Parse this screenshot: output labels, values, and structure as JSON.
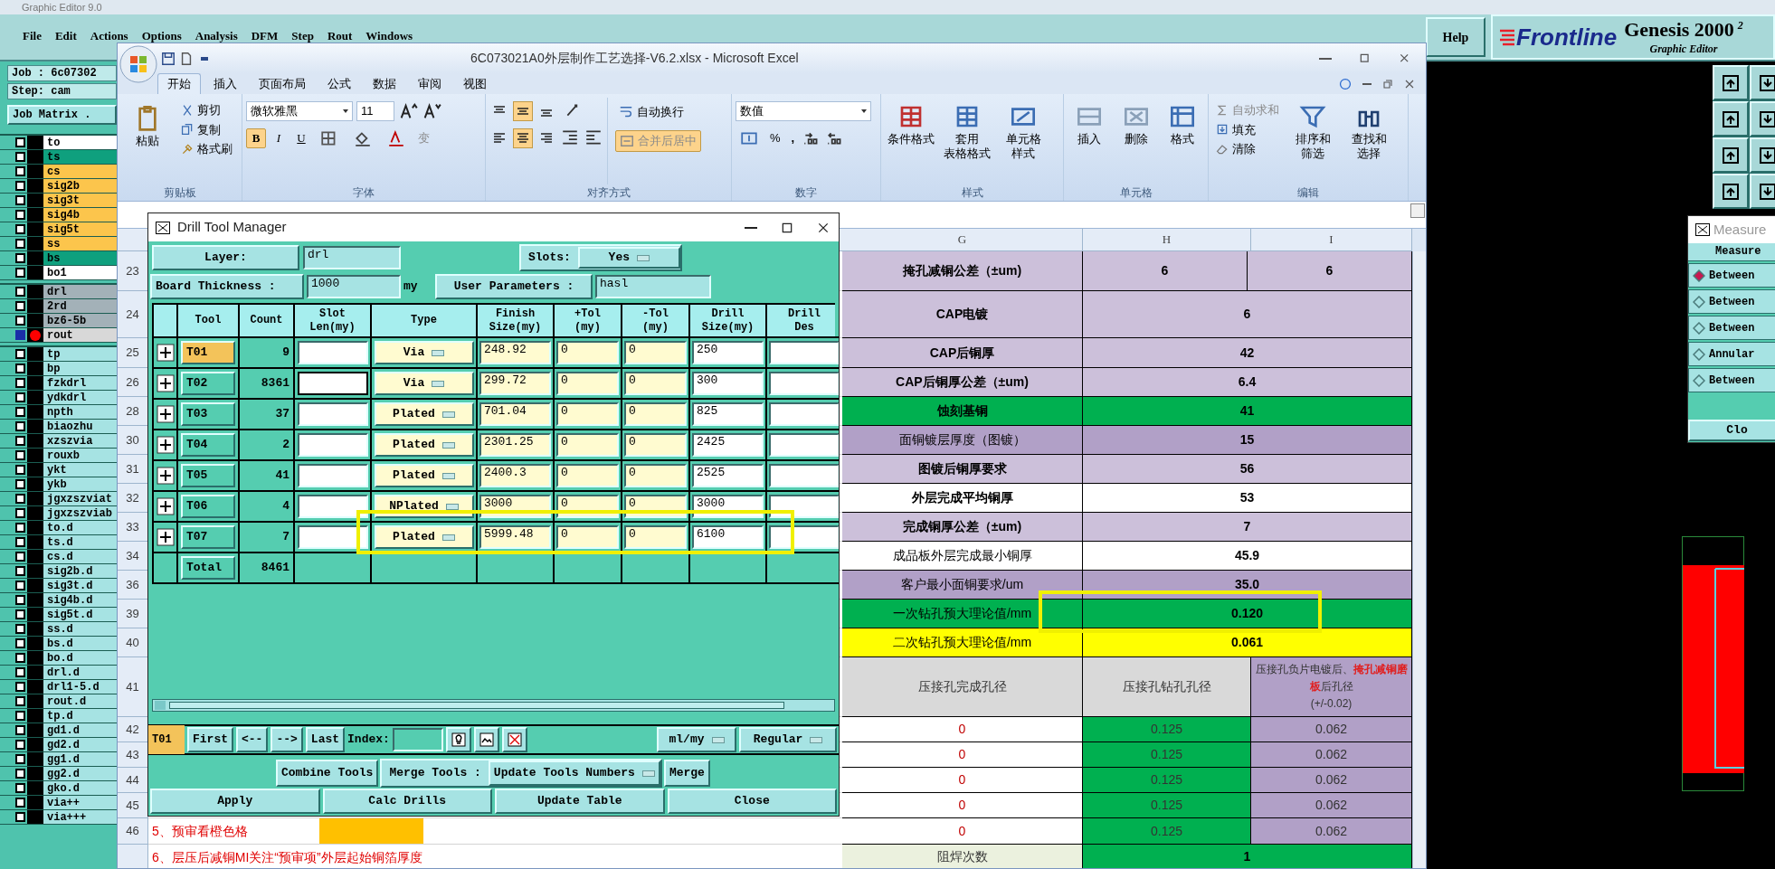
{
  "genesis": {
    "title": "Graphic Editor 9.0",
    "menu": [
      "File",
      "Edit",
      "Actions",
      "Options",
      "Analysis",
      "DFM",
      "Step",
      "Rout",
      "Windows"
    ],
    "help": "Help",
    "logo": {
      "brand": "Frontline",
      "product": "Genesis 2000",
      "superscript": "2",
      "subtitle": "Graphic Editor"
    },
    "job": "Job : 6c07302",
    "step": "Step: cam",
    "job_matrix": "Job Matrix .",
    "layer_groups": [
      {
        "layers": [
          {
            "name": "to",
            "color": "#ffffff",
            "selected": false
          },
          {
            "name": "ts",
            "color": "#0fa07e",
            "selected": false
          },
          {
            "name": "cs",
            "color": "#fcc54c",
            "selected": false
          },
          {
            "name": "sig2b",
            "color": "#fcc54c",
            "selected": false
          },
          {
            "name": "sig3t",
            "color": "#fcc54c",
            "selected": false
          },
          {
            "name": "sig4b",
            "color": "#fcc54c",
            "selected": false
          },
          {
            "name": "sig5t",
            "color": "#fcc54c",
            "selected": false
          },
          {
            "name": "ss",
            "color": "#fcc54c",
            "selected": false
          },
          {
            "name": "bs",
            "color": "#0fa07e",
            "selected": false
          },
          {
            "name": "bo1",
            "color": "#ffffff",
            "selected": false
          }
        ]
      },
      {
        "layers": [
          {
            "name": "drl",
            "color": "#a3b1b8",
            "selected": false
          },
          {
            "name": "2rd",
            "color": "#a3b1b8",
            "selected": false
          },
          {
            "name": "bz6-5b",
            "color": "#a3b1b8",
            "selected": false
          },
          {
            "name": "rout",
            "color": "#d8d8d8",
            "selected": true
          }
        ]
      },
      {
        "layers": [
          {
            "name": "tp",
            "color": "#a6e3e3",
            "selected": false
          },
          {
            "name": "bp",
            "color": "#a6e3e3",
            "selected": false
          },
          {
            "name": "fzkdrl",
            "color": "#a6e3e3",
            "selected": false
          },
          {
            "name": "ydkdrl",
            "color": "#a6e3e3",
            "selected": false
          },
          {
            "name": "npth",
            "color": "#a6e3e3",
            "selected": false
          },
          {
            "name": "biaozhu",
            "color": "#a6e3e3",
            "selected": false
          },
          {
            "name": "xzszvia",
            "color": "#a6e3e3",
            "selected": false
          },
          {
            "name": "rouxb",
            "color": "#a6e3e3",
            "selected": false
          },
          {
            "name": "ykt",
            "color": "#a6e3e3",
            "selected": false
          },
          {
            "name": "ykb",
            "color": "#a6e3e3",
            "selected": false
          },
          {
            "name": "jgxzszviat",
            "color": "#a6e3e3",
            "selected": false
          },
          {
            "name": "jgxzszviab",
            "color": "#a6e3e3",
            "selected": false
          },
          {
            "name": "to.d",
            "color": "#a6e3e3",
            "selected": false
          },
          {
            "name": "ts.d",
            "color": "#a6e3e3",
            "selected": false
          },
          {
            "name": "cs.d",
            "color": "#a6e3e3",
            "selected": false
          },
          {
            "name": "sig2b.d",
            "color": "#a6e3e3",
            "selected": false
          },
          {
            "name": "sig3t.d",
            "color": "#a6e3e3",
            "selected": false
          },
          {
            "name": "sig4b.d",
            "color": "#a6e3e3",
            "selected": false
          },
          {
            "name": "sig5t.d",
            "color": "#a6e3e3",
            "selected": false
          },
          {
            "name": "ss.d",
            "color": "#a6e3e3",
            "selected": false
          },
          {
            "name": "bs.d",
            "color": "#a6e3e3",
            "selected": false
          },
          {
            "name": "bo.d",
            "color": "#a6e3e3",
            "selected": false
          },
          {
            "name": "drl.d",
            "color": "#a6e3e3",
            "selected": false
          },
          {
            "name": "drl1-5.d",
            "color": "#a6e3e3",
            "selected": false
          },
          {
            "name": "rout.d",
            "color": "#a6e3e3",
            "selected": false
          },
          {
            "name": "tp.d",
            "color": "#a6e3e3",
            "selected": false
          },
          {
            "name": "gd1.d",
            "color": "#a6e3e3",
            "selected": false
          },
          {
            "name": "gd2.d",
            "color": "#a6e3e3",
            "selected": false
          },
          {
            "name": "gg1.d",
            "color": "#a6e3e3",
            "selected": false
          },
          {
            "name": "gg2.d",
            "color": "#a6e3e3",
            "selected": false
          },
          {
            "name": "gko.d",
            "color": "#a6e3e3",
            "selected": false
          },
          {
            "name": "via++",
            "color": "#a6e3e3",
            "selected": false
          },
          {
            "name": "via+++",
            "color": "#a6e3e3",
            "selected": false
          }
        ]
      }
    ]
  },
  "measure": {
    "title": "Measure",
    "header": "Measure",
    "options": [
      {
        "label": "Between",
        "selected": true
      },
      {
        "label": "Between",
        "selected": false
      },
      {
        "label": "Between",
        "selected": false
      },
      {
        "label": "Annular",
        "selected": false
      },
      {
        "label": "Between",
        "selected": false
      }
    ],
    "close": "Clo"
  },
  "excel": {
    "title": "6C073021A0外层制作工艺选择-V6.2.xlsx - Microsoft Excel",
    "tabs": [
      {
        "label": "开始",
        "selected": true
      },
      {
        "label": "插入",
        "selected": false
      },
      {
        "label": "页面布局",
        "selected": false
      },
      {
        "label": "公式",
        "selected": false
      },
      {
        "label": "数据",
        "selected": false
      },
      {
        "label": "审阅",
        "selected": false
      },
      {
        "label": "视图",
        "selected": false
      }
    ],
    "clipboard": {
      "label": "剪贴板",
      "paste": "粘贴",
      "cut": "剪切",
      "copy": "复制",
      "format_painter": "格式刷"
    },
    "font": {
      "label": "字体",
      "name": "微软雅黑",
      "size": "11",
      "bold": "B",
      "italic": "I",
      "underline": "U",
      "phonetic": "变"
    },
    "alignment": {
      "label": "对齐方式",
      "vertical": [
        {
          "selected": false
        },
        {
          "selected": true
        },
        {
          "selected": false
        }
      ],
      "horizontal": [
        {
          "selected": false
        },
        {
          "selected": true
        },
        {
          "selected": false
        }
      ],
      "wrap": "自动换行",
      "merge": {
        "label": "合并后居中",
        "disabled": true
      }
    },
    "number": {
      "label": "数字",
      "format": "数值",
      "percent": "%",
      "comma": ","
    },
    "styles": {
      "label": "样式",
      "conditional": "条件格式",
      "table": [
        "套用",
        "表格格式"
      ],
      "cell": [
        "单元格",
        "样式"
      ]
    },
    "cells": {
      "label": "单元格",
      "insert": "插入",
      "delete": "删除",
      "format": "格式"
    },
    "editing": {
      "label": "编辑",
      "autosum": {
        "label": "自动求和",
        "disabled": true
      },
      "fill": "填充",
      "clear": "清除",
      "sort": [
        "排序和",
        "筛选"
      ],
      "find": [
        "查找和",
        "选择"
      ]
    },
    "columns": [
      "G",
      "H",
      "I"
    ],
    "rows": [
      {
        "kind": "param",
        "number": "23",
        "label": "掩孔减铜公差（±um)",
        "values": [
          "6",
          "6"
        ],
        "color": "#ccc0da",
        "label_bold": true,
        "value_bold": true
      },
      {
        "kind": "param",
        "number": "24",
        "label": "CAP电镀",
        "values": [
          "6"
        ],
        "color": "#ccc0da",
        "label_bold": true,
        "value_bold": true
      },
      {
        "kind": "param",
        "number": "25",
        "label": "CAP后铜厚",
        "values": [
          "42"
        ],
        "color": "#ccc0da",
        "label_bold": true,
        "value_bold": true
      },
      {
        "kind": "param",
        "number": "26",
        "label": "CAP后铜厚公差（±um)",
        "values": [
          "6.4"
        ],
        "color": "#ccc0da",
        "label_bold": true,
        "value_bold": true
      },
      {
        "kind": "param",
        "number": "28",
        "label": "蚀刻基铜",
        "values": [
          "41"
        ],
        "color": "#00b050",
        "label_bold": true,
        "value_bold": true
      },
      {
        "kind": "param",
        "number": "30",
        "label": "面铜镀层厚度（图镀）",
        "values": [
          "15"
        ],
        "color": "#b1a0c7",
        "label_bold": false,
        "value_bold": true
      },
      {
        "kind": "param",
        "number": "31",
        "label": "图镀后铜厚要求",
        "values": [
          "56"
        ],
        "color": "#ccc0da",
        "label_bold": true,
        "value_bold": true
      },
      {
        "kind": "param",
        "number": "32",
        "label": "外层完成平均铜厚",
        "values": [
          "53"
        ],
        "color": "#ffffff",
        "label_bold": true,
        "value_bold": true
      },
      {
        "kind": "param",
        "number": "33",
        "label": "完成铜厚公差（±um)",
        "values": [
          "7"
        ],
        "color": "#ccc0da",
        "label_bold": true,
        "value_bold": true
      },
      {
        "kind": "param",
        "number": "34",
        "label": "成品板外层完成最小铜厚",
        "values": [
          "45.9"
        ],
        "color": "#ffffff",
        "label_bold": false,
        "value_bold": true
      },
      {
        "kind": "param",
        "number": "36",
        "label": "客户最小面铜要求/um",
        "values": [
          "35.0"
        ],
        "color": "#b1a0c7",
        "label_bold": false,
        "value_bold": true
      },
      {
        "kind": "param",
        "number": "39",
        "label": "一次钻孔预大理论值/mm",
        "values": [
          "0.120"
        ],
        "color": "#00b050",
        "label_bold": false,
        "value_bold": true
      },
      {
        "kind": "param",
        "number": "40",
        "label": "二次钻孔预大理论值/mm",
        "values": [
          "0.061"
        ],
        "color": "#ffff00",
        "label_bold": false,
        "value_bold": true
      },
      {
        "kind": "header",
        "number": "41",
        "cells": [
          "压接孔完成孔径",
          "压接孔钻孔孔径"
        ],
        "parts": [
          {
            "text": "压接孔负片电镀后、",
            "emphasis": false
          },
          {
            "text": "掩孔减铜磨板",
            "emphasis": true
          },
          {
            "text": "后孔径",
            "emphasis": false
          }
        ],
        "note": "(+/-0.02)"
      },
      {
        "kind": "data",
        "number": "42",
        "cells": [
          "0",
          "0.125",
          "0.062"
        ]
      },
      {
        "kind": "data",
        "number": "43",
        "cells": [
          "0",
          "0.125",
          "0.062"
        ]
      },
      {
        "kind": "data",
        "number": "44",
        "cells": [
          "0",
          "0.125",
          "0.062"
        ]
      },
      {
        "kind": "data",
        "number": "45",
        "cells": [
          "0",
          "0.125",
          "0.062"
        ]
      },
      {
        "kind": "data",
        "number": "46",
        "cells": [
          "0",
          "0.125",
          "0.062"
        ],
        "left_text": "5、预审看橙色格",
        "left_fill": {
          "color": "#ffc000"
        }
      },
      {
        "kind": "footer",
        "cells": [
          "阻焊次数",
          "1"
        ],
        "left_text": "6、层压后减铜MI关注“预审项”外层起始铜箔厚度"
      }
    ]
  },
  "drill": {
    "title": "Drill Tool Manager",
    "layer": {
      "label": "Layer",
      "separator": ":",
      "value": "drl"
    },
    "slots": {
      "label": "Slots:",
      "value": "Yes"
    },
    "thickness": {
      "label": "Board Thickness :",
      "value": "1000",
      "unit": "my"
    },
    "user_params": {
      "label": "User Parameters :",
      "value": "hasl"
    },
    "columns": [
      {
        "lines": [
          "Tool"
        ]
      },
      {
        "lines": [
          "Count"
        ]
      },
      {
        "lines": [
          "Slot",
          "Len(my)"
        ]
      },
      {
        "lines": [
          "Type"
        ]
      },
      {
        "lines": [
          "Finish",
          "Size(my)"
        ]
      },
      {
        "lines": [
          "+Tol",
          "(my)"
        ]
      },
      {
        "lines": [
          "-Tol",
          "(my)"
        ]
      },
      {
        "lines": [
          "Drill",
          "Size(my)"
        ]
      },
      {
        "lines": [
          "Drill",
          "Des"
        ]
      }
    ],
    "tools": [
      {
        "tool": "T01",
        "count": "9",
        "type": "Via",
        "finish": "248.92",
        "plus_tol": "0",
        "minus_tol": "0",
        "drill_size": "250",
        "selected": true,
        "slot_focused": false
      },
      {
        "tool": "T02",
        "count": "8361",
        "type": "Via",
        "finish": "299.72",
        "plus_tol": "0",
        "minus_tol": "0",
        "drill_size": "300",
        "selected": false,
        "slot_focused": true
      },
      {
        "tool": "T03",
        "count": "37",
        "type": "Plated",
        "finish": "701.04",
        "plus_tol": "0",
        "minus_tol": "0",
        "drill_size": "825",
        "selected": false,
        "slot_focused": false
      },
      {
        "tool": "T04",
        "count": "2",
        "type": "Plated",
        "finish": "2301.25",
        "plus_tol": "0",
        "minus_tol": "0",
        "drill_size": "2425",
        "selected": false,
        "slot_focused": false
      },
      {
        "tool": "T05",
        "count": "41",
        "type": "Plated",
        "finish": "2400.3",
        "plus_tol": "0",
        "minus_tol": "0",
        "drill_size": "2525",
        "selected": false,
        "slot_focused": false
      },
      {
        "tool": "T06",
        "count": "4",
        "type": "NPlated",
        "finish": "3000",
        "plus_tol": "0",
        "minus_tol": "0",
        "drill_size": "3000",
        "selected": false,
        "slot_focused": false
      },
      {
        "tool": "T07",
        "count": "7",
        "type": "Plated",
        "finish": "5999.48",
        "plus_tol": "0",
        "minus_tol": "0",
        "drill_size": "6100",
        "selected": false,
        "slot_focused": false
      }
    ],
    "total": {
      "label": "Total",
      "count": "8461"
    },
    "nav": {
      "current": "T01",
      "first": "First",
      "prev": "<--",
      "next": "-->",
      "last": "Last",
      "index_label": "Index:",
      "units": "ml/my",
      "mode": "Regular"
    },
    "merge": {
      "combine": "Combine Tools",
      "label": "Merge Tools :",
      "mode": "Update Tools Numbers",
      "merge": "Merge"
    },
    "buttons": [
      "Apply",
      "Calc Drills",
      "Update Table",
      "Close"
    ]
  }
}
